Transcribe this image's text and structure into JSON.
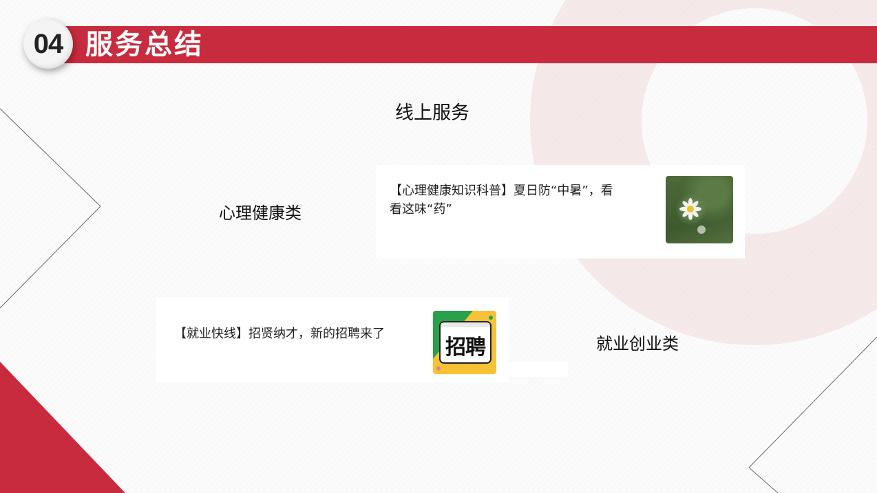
{
  "header": {
    "number": "04",
    "title": "服务总结"
  },
  "section": {
    "title": "线上服务"
  },
  "categories": {
    "mental_health": "心理健康类",
    "employment": "就业创业类"
  },
  "articles": [
    {
      "line1": "【心理健康知识科普】夏日防“中暑”，看",
      "line2": "看这味“药”",
      "thumbnail": "daisy-photo"
    },
    {
      "line1": "【就业快线】招贤纳才，新的招聘来了",
      "thumbnail_text": "招聘"
    }
  ],
  "colors": {
    "accent": "#c92b3e",
    "ring": "#ecc8cc",
    "background": "#fbfbfb"
  }
}
